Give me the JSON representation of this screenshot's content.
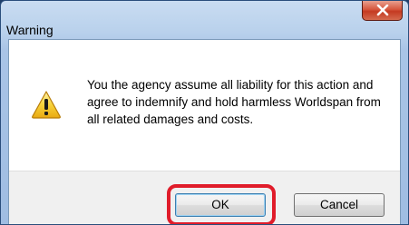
{
  "window": {
    "title": "Warning",
    "close_icon": "close-icon"
  },
  "dialog": {
    "icon": "warning-icon",
    "message": "You the agency assume all liability for this action and agree to indemnify and hold harmless Worldspan from all related damages and costs."
  },
  "buttons": {
    "ok_label": "OK",
    "cancel_label": "Cancel"
  },
  "colors": {
    "highlight": "#e01c2a",
    "close_button": "#c43a21"
  }
}
